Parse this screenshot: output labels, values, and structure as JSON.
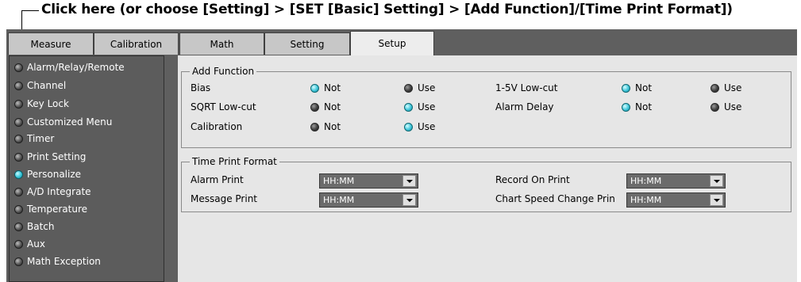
{
  "callout": "Click here (or choose [Setting] > [SET [Basic] Setting] > [Add Function]/[Time Print Format])",
  "tabs": [
    {
      "label": "Measure"
    },
    {
      "label": "Calibration"
    },
    {
      "label": "Math"
    },
    {
      "label": "Setting"
    },
    {
      "label": "Setup",
      "active": true
    }
  ],
  "sidebar": {
    "items": [
      {
        "label": "Alarm/Relay/Remote"
      },
      {
        "label": "Channel"
      },
      {
        "label": "Key Lock"
      },
      {
        "label": "Customized Menu"
      },
      {
        "label": "Timer"
      },
      {
        "label": "Print Setting"
      },
      {
        "label": "Personalize",
        "selected": true
      },
      {
        "label": "A/D Integrate"
      },
      {
        "label": "Temperature"
      },
      {
        "label": "Batch"
      },
      {
        "label": "Aux"
      },
      {
        "label": "Math Exception"
      }
    ]
  },
  "add_function": {
    "title": "Add Function",
    "not_label": "Not",
    "use_label": "Use",
    "rows": [
      {
        "label": "Bias",
        "value": "Not"
      },
      {
        "label": "SQRT Low-cut",
        "value": "Use"
      },
      {
        "label": "Calibration",
        "value": "Use"
      },
      {
        "label": "1-5V Low-cut",
        "value": "Not"
      },
      {
        "label": "Alarm Delay",
        "value": "Not"
      }
    ]
  },
  "time_print_format": {
    "title": "Time Print Format",
    "rows": [
      {
        "label": "Alarm Print",
        "value": "HH:MM"
      },
      {
        "label": "Message Print",
        "value": "HH:MM"
      },
      {
        "label": "Record On Print",
        "value": "HH:MM"
      },
      {
        "label": "Chart Speed Change Prin",
        "value": "HH:MM"
      }
    ]
  },
  "colors": {
    "radio_on": "#3ec6da",
    "radio_off": "#3f3f3f",
    "panel_bg": "#e6e6e6",
    "frame_bg": "#5f5f5f"
  }
}
